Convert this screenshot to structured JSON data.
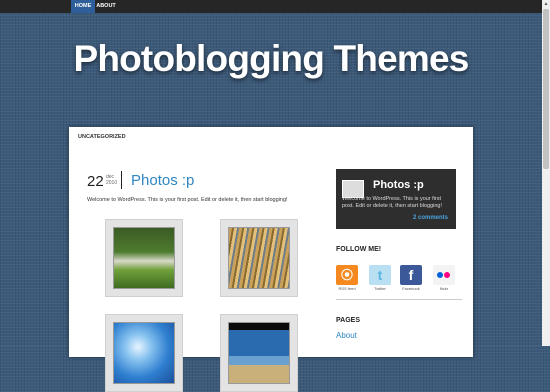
{
  "nav": {
    "items": [
      {
        "label": "HOME"
      },
      {
        "label": "ABOUT"
      }
    ]
  },
  "site": {
    "title": "Photoblogging Themes"
  },
  "content": {
    "category": "UNCATEGORIZED",
    "post": {
      "day": "22",
      "month": "dec",
      "year": "2010",
      "title": "Photos :p",
      "excerpt": "Welcome to WordPress. This is your first post. Edit or delete it, then start blogging!"
    }
  },
  "sidebar": {
    "featured": {
      "title": "Photos :p",
      "text": "Welcome to WordPress. This is your first post. Edit or delete it, then start blogging!",
      "comments": "2 comments"
    },
    "follow_title": "FOLLOW ME!",
    "social": [
      {
        "name": "rss-icon",
        "label": "RSS feed"
      },
      {
        "name": "twitter-icon",
        "label": "Twitter"
      },
      {
        "name": "facebook-icon",
        "label": "Facebook"
      },
      {
        "name": "flickr-icon",
        "label": "flickr"
      }
    ],
    "pages_title": "PAGES",
    "pages": [
      {
        "label": "About"
      }
    ]
  },
  "colors": {
    "background": "#3c5a7a",
    "topbar": "#262626",
    "nav_active": "#2f5f9a",
    "link": "#2f87c2",
    "widget_bg": "#2e2e2e"
  }
}
